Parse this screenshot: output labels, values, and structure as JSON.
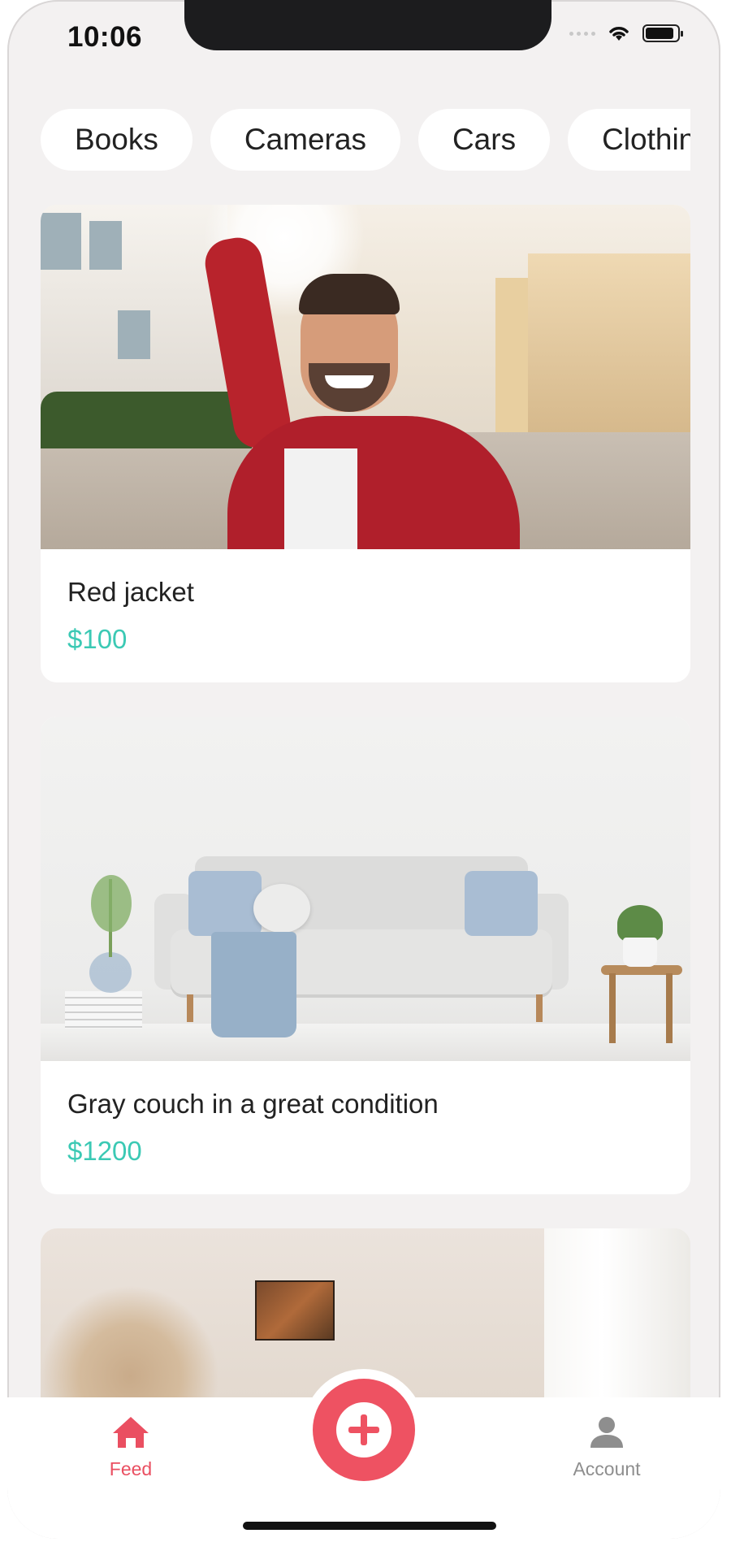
{
  "status": {
    "time": "10:06"
  },
  "categories": [
    "Books",
    "Cameras",
    "Cars",
    "Clothing"
  ],
  "listings": [
    {
      "title": "Red jacket",
      "price": "$100"
    },
    {
      "title": "Gray couch in a great condition",
      "price": "$1200"
    }
  ],
  "tabbar": {
    "feed_label": "Feed",
    "account_label": "Account"
  },
  "colors": {
    "accent": "#ee5262",
    "price": "#3bc9b4",
    "background": "#f3f1f1"
  },
  "icons": {
    "feed": "home-icon",
    "add": "plus-circle-icon",
    "account": "person-icon"
  }
}
